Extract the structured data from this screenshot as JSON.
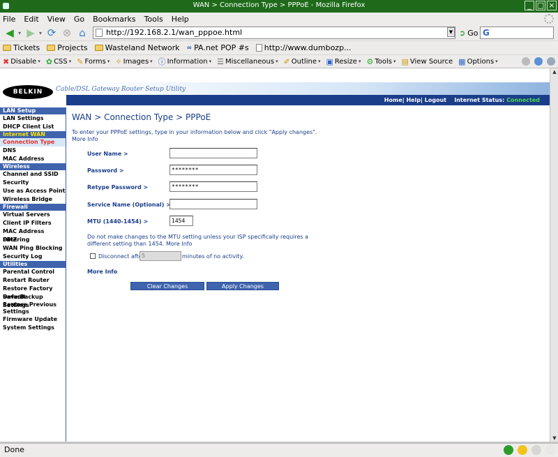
{
  "window": {
    "title": "WAN > Connection Type > PPPoE - Mozilla Firefox"
  },
  "menu": [
    "File",
    "Edit",
    "View",
    "Go",
    "Bookmarks",
    "Tools",
    "Help"
  ],
  "nav": {
    "url": "http://192.168.2.1/wan_pppoe.html",
    "go_label": "Go",
    "search_value": ""
  },
  "bookmarks": [
    {
      "label": "Tickets",
      "icon": "folder-icon"
    },
    {
      "label": "Projects",
      "icon": "folder-icon"
    },
    {
      "label": "Wasteland Network",
      "icon": "folder-icon"
    },
    {
      "label": "PA.net POP #s",
      "icon": "pa-icon"
    },
    {
      "label": "http://www.dumbozp...",
      "icon": "page-icon"
    }
  ],
  "devbar": [
    "Disable",
    "CSS",
    "Forms",
    "Images",
    "Information",
    "Miscellaneous",
    "Outline",
    "Resize",
    "Tools",
    "View Source",
    "Options"
  ],
  "router": {
    "logo": "BELKIN",
    "tagline": "Cable/DSL Gateway Router Setup Utility",
    "toplinks": "Home| Help| Logout",
    "internet_status_label": "Internet Status:",
    "internet_status_value": "Connected"
  },
  "sidebar": {
    "lan_setup": "LAN Setup",
    "lan_settings": "LAN Settings",
    "dhcp_client_list": "DHCP Client List",
    "internet_wan": "Internet WAN",
    "connection_type": "Connection Type",
    "dns": "DNS",
    "mac_address": "MAC Address",
    "wireless": "Wireless",
    "channel_ssid": "Channel and SSID",
    "security": "Security",
    "use_as_ap": "Use as Access Point",
    "wireless_bridge": "Wireless Bridge",
    "firewall": "Firewall",
    "virtual_servers": "Virtual Servers",
    "client_ip_filters": "Client IP Filters",
    "mac_address_filtering": "MAC Address Filtering",
    "dmz": "DMZ",
    "wan_ping_blocking": "WAN Ping Blocking",
    "security_log": "Security Log",
    "utilities": "Utilities",
    "parental_control": "Parental Control",
    "restart_router": "Restart Router",
    "restore_factory_default": "Restore Factory Default",
    "save_backup_settings": "Save/Backup Settings",
    "restore_previous_settings": "Restore Previous Settings",
    "firmware_update": "Firmware Update",
    "system_settings": "System Settings"
  },
  "main": {
    "heading": "WAN > Connection Type > PPPoE",
    "intro": "To enter your PPPoE settings, type in your information below and click \"Apply changes\".",
    "intro_more": "More Info",
    "user_name_label": "User Name >",
    "user_name_value": "",
    "password_label": "Password >",
    "password_value": "********",
    "retype_password_label": "Retype Password >",
    "retype_password_value": "********",
    "service_name_label": "Service Name (Optional) >",
    "service_name_value": "",
    "mtu_label": "MTU (1440-1454) >",
    "mtu_value": "1454",
    "mtu_note": "Do not make changes to the MTU setting unless your ISP specifically requires a different setting than 1454.",
    "mtu_more": "More Info",
    "disconnect_prefix": "Disconnect after",
    "disconnect_value": "5",
    "disconnect_suffix": "minutes of no activity.",
    "more_info": "More Info",
    "clear_button": "Clear Changes",
    "apply_button": "Apply Changes"
  },
  "status": {
    "text": "Done"
  }
}
